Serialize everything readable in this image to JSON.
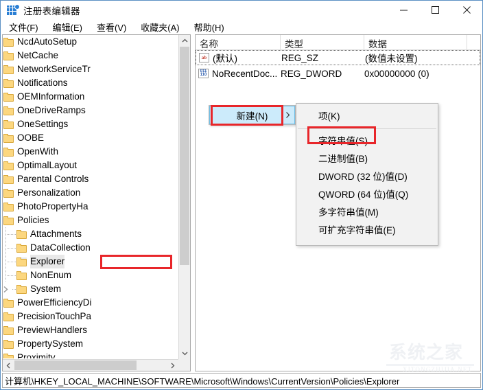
{
  "window": {
    "title": "注册表编辑器",
    "icon": "registry-editor-icon",
    "minimize_label": "最小化",
    "maximize_label": "最大化",
    "close_label": "关闭"
  },
  "menubar": {
    "items": [
      {
        "label": "文件(F)",
        "name": "menu-file"
      },
      {
        "label": "编辑(E)",
        "name": "menu-edit"
      },
      {
        "label": "查看(V)",
        "name": "menu-view"
      },
      {
        "label": "收藏夹(A)",
        "name": "menu-favorites"
      },
      {
        "label": "帮助(H)",
        "name": "menu-help"
      }
    ]
  },
  "tree": {
    "nodes": [
      {
        "label": "NcdAutoSetup",
        "depth": 5,
        "expander": "collapsed",
        "selected": false
      },
      {
        "label": "NetCache",
        "depth": 5,
        "expander": "collapsed",
        "selected": false
      },
      {
        "label": "NetworkServiceTr",
        "depth": 5,
        "expander": "collapsed",
        "selected": false
      },
      {
        "label": "Notifications",
        "depth": 5,
        "expander": "collapsed",
        "selected": false
      },
      {
        "label": "OEMInformation",
        "depth": 5,
        "expander": "none",
        "selected": false
      },
      {
        "label": "OneDriveRamps",
        "depth": 5,
        "expander": "none",
        "selected": false
      },
      {
        "label": "OneSettings",
        "depth": 5,
        "expander": "collapsed",
        "selected": false
      },
      {
        "label": "OOBE",
        "depth": 5,
        "expander": "collapsed",
        "selected": false
      },
      {
        "label": "OpenWith",
        "depth": 5,
        "expander": "none",
        "selected": false
      },
      {
        "label": "OptimalLayout",
        "depth": 5,
        "expander": "none",
        "selected": false
      },
      {
        "label": "Parental Controls",
        "depth": 5,
        "expander": "collapsed",
        "selected": false
      },
      {
        "label": "Personalization",
        "depth": 5,
        "expander": "none",
        "selected": false
      },
      {
        "label": "PhotoPropertyHa",
        "depth": 5,
        "expander": "collapsed",
        "selected": false
      },
      {
        "label": "Policies",
        "depth": 5,
        "expander": "expanded",
        "selected": false
      },
      {
        "label": "Attachments",
        "depth": 6,
        "expander": "none",
        "selected": false
      },
      {
        "label": "DataCollection",
        "depth": 6,
        "expander": "none",
        "selected": false
      },
      {
        "label": "Explorer",
        "depth": 6,
        "expander": "none",
        "selected": true
      },
      {
        "label": "NonEnum",
        "depth": 6,
        "expander": "none",
        "selected": false
      },
      {
        "label": "System",
        "depth": 6,
        "expander": "collapsed",
        "selected": false
      },
      {
        "label": "PowerEfficiencyDi",
        "depth": 5,
        "expander": "none",
        "selected": false
      },
      {
        "label": "PrecisionTouchPa",
        "depth": 5,
        "expander": "collapsed",
        "selected": false
      },
      {
        "label": "PreviewHandlers",
        "depth": 5,
        "expander": "none",
        "selected": false
      },
      {
        "label": "PropertySystem",
        "depth": 5,
        "expander": "collapsed",
        "selected": false
      },
      {
        "label": "Proximity",
        "depth": 5,
        "expander": "collapsed",
        "selected": false
      }
    ]
  },
  "list": {
    "columns": [
      "名称",
      "类型",
      "数据"
    ],
    "rows": [
      {
        "icon": "string-value-icon",
        "name": "(默认)",
        "type": "REG_SZ",
        "data": "(数值未设置)",
        "focused": true
      },
      {
        "icon": "dword-value-icon",
        "name": "NoRecentDoc...",
        "type": "REG_DWORD",
        "data": "0x00000000 (0)",
        "focused": false
      }
    ]
  },
  "context_menu": {
    "item_label": "新建(N)",
    "submenu_arrow": "chevron-right-icon",
    "submenu": [
      {
        "label": "项(K)",
        "highlighted": false,
        "separator_after": true
      },
      {
        "label": "字符串值(S)",
        "highlighted": true,
        "separator_after": false
      },
      {
        "label": "二进制值(B)",
        "highlighted": false,
        "separator_after": false
      },
      {
        "label": "DWORD (32 位)值(D)",
        "highlighted": false,
        "separator_after": false
      },
      {
        "label": "QWORD (64 位)值(Q)",
        "highlighted": false,
        "separator_after": false
      },
      {
        "label": "多字符串值(M)",
        "highlighted": false,
        "separator_after": false
      },
      {
        "label": "可扩充字符串值(E)",
        "highlighted": false,
        "separator_after": false
      }
    ]
  },
  "statusbar": {
    "path": "计算机\\HKEY_LOCAL_MACHINE\\SOFTWARE\\Microsoft\\Windows\\CurrentVersion\\Policies\\Explorer"
  },
  "watermark": {
    "cn": "系统之家",
    "en": "XITONGZHIJIA.NET"
  },
  "colors": {
    "annotation_red": "#e8262a",
    "menu_highlight": "#ccebfb",
    "folder": "#fcd77f",
    "accent": "#2a7fd4"
  }
}
